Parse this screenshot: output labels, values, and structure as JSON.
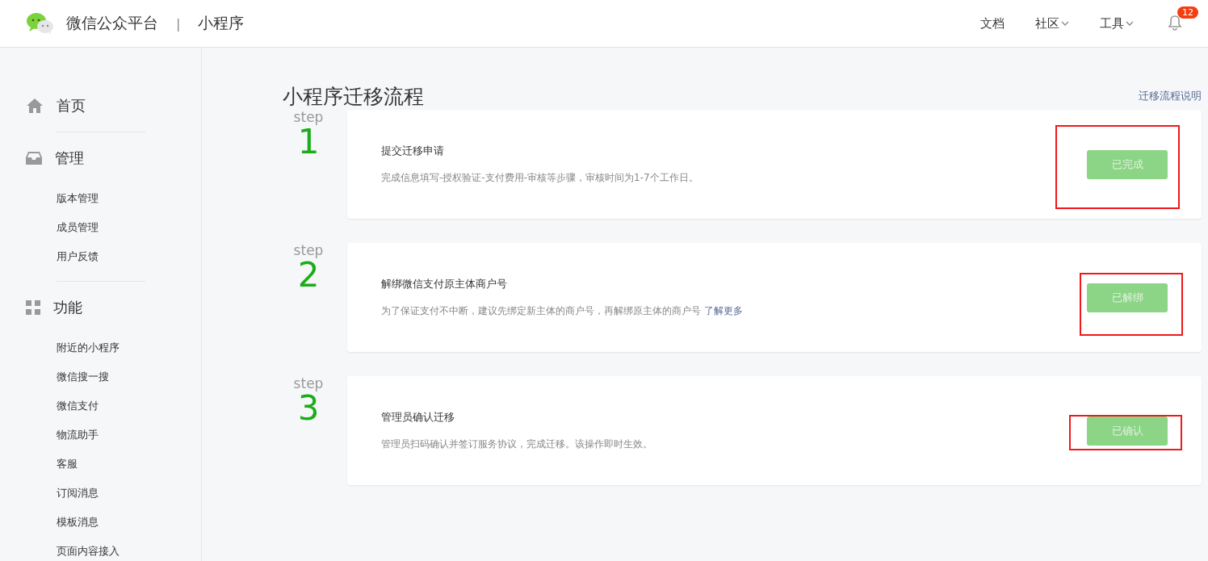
{
  "header": {
    "brand": "微信公众平台",
    "separator": "|",
    "product": "小程序",
    "nav": [
      {
        "label": "文档",
        "dropdown": false
      },
      {
        "label": "社区",
        "dropdown": true
      },
      {
        "label": "工具",
        "dropdown": true
      }
    ],
    "notifications": "12"
  },
  "sidebar": {
    "sections": [
      {
        "kind": "home",
        "label": "首页"
      },
      {
        "kind": "manage",
        "label": "管理",
        "items": [
          "版本管理",
          "成员管理",
          "用户反馈"
        ]
      },
      {
        "kind": "features",
        "label": "功能",
        "items": [
          "附近的小程序",
          "微信搜一搜",
          "微信支付",
          "物流助手",
          "客服",
          "订阅消息",
          "模板消息",
          "页面内容接入"
        ]
      }
    ]
  },
  "page": {
    "title": "小程序迁移流程",
    "help_link": "迁移流程说明"
  },
  "steps": [
    {
      "step_label": "step",
      "number": "1",
      "title": "提交迁移申请",
      "description": "完成信息填写-授权验证-支付费用-审核等步骤，审核时间为1-7个工作日。",
      "button": "已完成",
      "disabled": true,
      "annotated": true
    },
    {
      "step_label": "step",
      "number": "2",
      "title": "解绑微信支付原主体商户号",
      "description": "为了保证支付不中断，建议先绑定新主体的商户号，再解绑原主体的商户号",
      "link": "了解更多",
      "button": "已解绑",
      "disabled": true,
      "annotated": true
    },
    {
      "step_label": "step",
      "number": "3",
      "title": "管理员确认迁移",
      "description": "管理员扫码确认并签订服务协议，完成迁移。该操作即时生效。",
      "button": "已确认",
      "disabled": true,
      "annotated": true
    }
  ]
}
